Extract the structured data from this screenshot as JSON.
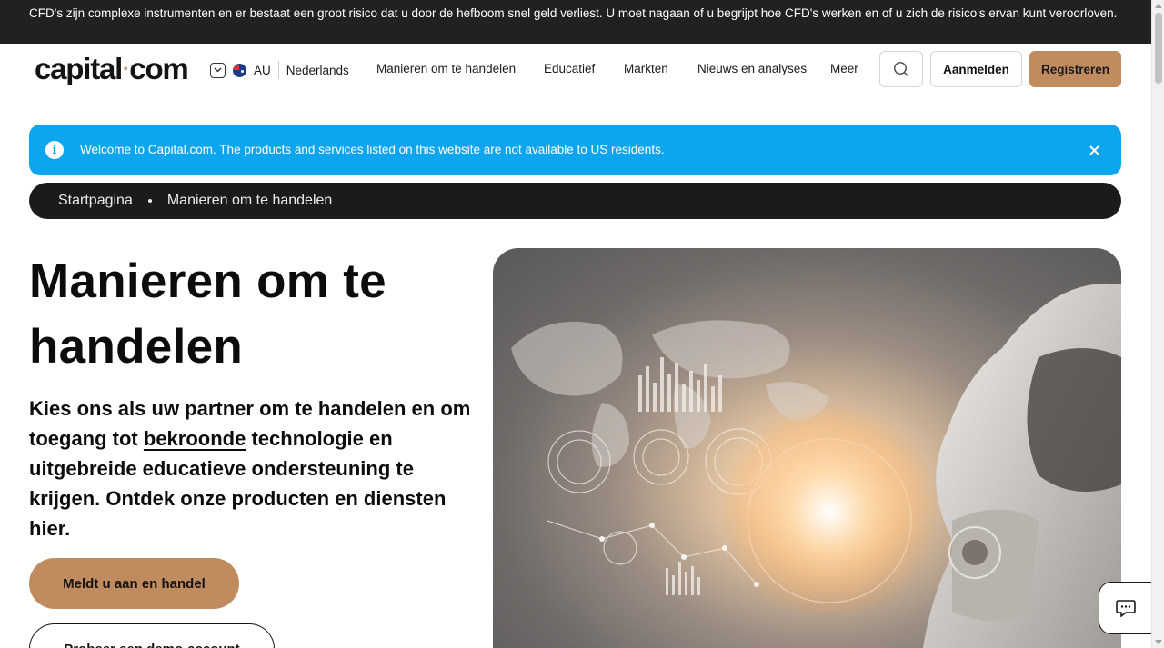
{
  "risk_warning": "CFD's zijn complexe instrumenten en er bestaat een groot risico dat u door de hefboom snel geld verliest. U moet nagaan of u begrijpt hoe CFD's werken en of u zich de risico's ervan kunt veroorloven.",
  "header": {
    "logo_left": "capital",
    "logo_dot": "·",
    "logo_right": "com",
    "region_code": "AU",
    "language": "Nederlands",
    "nav": [
      "Manieren om te handelen",
      "Educatief",
      "Markten",
      "Nieuws en analyses",
      "Meer"
    ],
    "login_label": "Aanmelden",
    "register_label": "Registreren"
  },
  "notice": {
    "text": "Welcome to Capital.com. The products and services listed on this website are not available to US residents.",
    "info_glyph": "i",
    "close_glyph": "✕"
  },
  "breadcrumb": [
    "Startpagina",
    "Manieren om te handelen"
  ],
  "hero": {
    "title": "Manieren om te handelen",
    "subtitle_before": "Kies ons als uw partner om te handelen en om toegang tot ",
    "subtitle_link": "bekroonde",
    "subtitle_after": " technologie en uitgebreide educatieve ondersteuning te krijgen. Ontdek onze producten en diensten hier.",
    "cta_primary": "Meldt u aan en handel",
    "cta_secondary": "Probeer een demo-account"
  },
  "icons": {
    "search": "search-icon",
    "chat": "chat-icon",
    "info": "info-icon",
    "close": "close-icon",
    "region_dropdown": "chevron-down-icon",
    "flag": "australia-flag-icon"
  },
  "colors": {
    "accent": "#c08b5f",
    "notice_blue": "#0ea5ef",
    "dark": "#1b1b1b",
    "risk_bar": "#212121"
  }
}
